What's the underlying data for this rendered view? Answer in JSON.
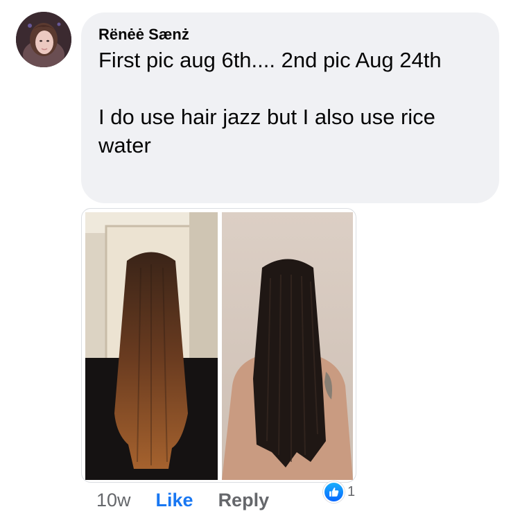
{
  "comment": {
    "author": "Rënėė Sænż",
    "text_lines": [
      "First pic aug 6th.... 2nd pic Aug 24th",
      "I do use hair jazz but I also use rice water"
    ],
    "photos": [
      {
        "name": "first-photo",
        "description_icon": "hair-photo"
      },
      {
        "name": "second-photo",
        "description_icon": "hair-photo"
      }
    ]
  },
  "actions": {
    "time": "10w",
    "like_label": "Like",
    "reply_label": "Reply"
  },
  "reactions": {
    "icon": "like-icon",
    "count": "1",
    "color": "#1877f2"
  }
}
